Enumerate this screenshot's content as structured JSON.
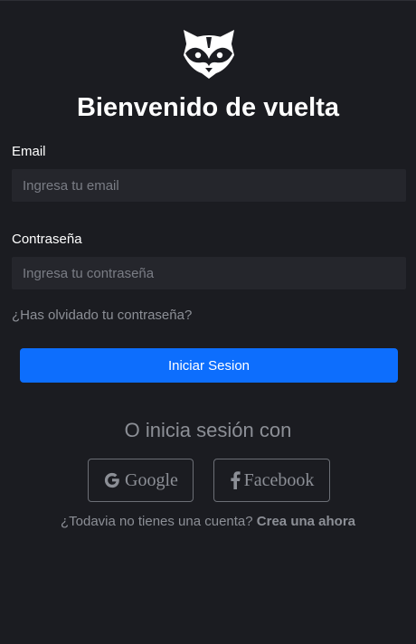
{
  "header": {
    "logo_icon": "raccoon-icon",
    "title": "Bienvenido de vuelta"
  },
  "form": {
    "email": {
      "label": "Email",
      "value": "",
      "placeholder": "Ingresa tu email"
    },
    "password": {
      "label": "Contraseña",
      "value": "",
      "placeholder": "Ingresa tu contraseña"
    },
    "forgot_password": "¿Has olvidado tu contraseña?",
    "submit_label": "Iniciar Sesion"
  },
  "social": {
    "heading": "O inicia sesión con",
    "google": {
      "icon": "google-icon",
      "label": "Google"
    },
    "facebook": {
      "icon": "facebook-icon",
      "label": "Facebook"
    }
  },
  "signup": {
    "prompt": "¿Todavia no tienes una cuenta?",
    "link": "Crea una ahora"
  },
  "colors": {
    "background": "#1b1c21",
    "input_background": "#25262c",
    "primary": "#0d6efd",
    "muted_text": "#8c8f96"
  }
}
